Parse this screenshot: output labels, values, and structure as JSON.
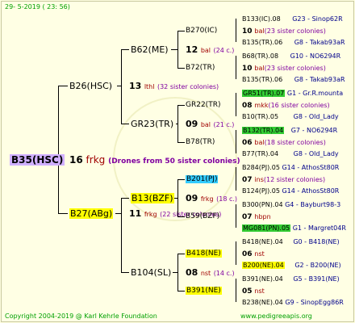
{
  "header": {
    "timestamp": "29-  5-2019 ( 23: 56)"
  },
  "footer": {
    "copyright": "Copyright 2004-2019 @ Karl Kehrle Foundation",
    "site": "www.pedigreeapis.org"
  },
  "root": {
    "label": "B35(HSC)"
  },
  "center": {
    "gen": "16",
    "code": "frkg",
    "note": "(Drones from 50 sister colonies)"
  },
  "p1": {
    "label": "B26(HSC)",
    "gen": "13",
    "code": "lthl",
    "note": "(32 sister colonies)"
  },
  "p2": {
    "label": "B27(ABg)",
    "gen": "11",
    "code": "frkg",
    "note": "(22 sister colonies)"
  },
  "g1": {
    "label": "B62(ME)",
    "gen": "12",
    "code": "bal",
    "note": "(24 c.)"
  },
  "g2": {
    "label": "GR23(TR)",
    "gen": "09",
    "code": "bal",
    "note": "(21 c.)"
  },
  "g3": {
    "label": "B13(BZF)",
    "gen": "09",
    "code": "frkg",
    "note": "(18 c.)"
  },
  "g4": {
    "label": "B104(SL)",
    "gen": "08",
    "code": "nst",
    "note": "(14 c.)"
  },
  "gg": [
    {
      "label": "B270(IC)",
      "gen": "10",
      "code": "bal",
      "note": "(23 sister colonies)"
    },
    {
      "label": "B72(TR)",
      "gen": "10",
      "code": "bal",
      "note": "(23 sister colonies)"
    },
    {
      "label": "GR22(TR)",
      "gen": "08",
      "code": "mkk",
      "note": "(16 sister colonies)"
    },
    {
      "label": "B78(TR)",
      "gen": "06",
      "code": "bal",
      "note": "(18 sister colonies)"
    },
    {
      "label": "B201(PJ)",
      "gen": "07",
      "code": "ins",
      "note": "(12 sister colonies)"
    },
    {
      "label": "B59(BZF)",
      "gen": "07",
      "code": "hbpn",
      "note": ""
    },
    {
      "label": "B418(NE)",
      "gen": "06",
      "code": "nst",
      "note": ""
    },
    {
      "label": "B391(NE)",
      "gen": "05",
      "code": "nst",
      "note": ""
    }
  ],
  "ggg": [
    {
      "id": "B133(IC).08",
      "info": "G23 - Sinop62R"
    },
    {
      "id": "B135(TR).06",
      "info": "G8 - Takab93aR"
    },
    {
      "id": "B68(TR).08",
      "info": "G10 - NO6294R"
    },
    {
      "id": "B135(TR).06",
      "info": "G8 - Takab93aR"
    },
    {
      "id": "GR51(TR).07",
      "info": "G1 - Gr.R.mounta"
    },
    {
      "id": "B10(TR).05",
      "info": "G8 - Old_Lady"
    },
    {
      "id": "B132(TR).04",
      "info": "G7 - NO6294R"
    },
    {
      "id": "B77(TR).04",
      "info": "G8 - Old_Lady"
    },
    {
      "id": "B284(PJ).05",
      "info": "G14 - AthosSt80R"
    },
    {
      "id": "B124(PJ).05",
      "info": "G14 - AthosSt80R"
    },
    {
      "id": "B300(PN).04",
      "info": "G4 - Bayburt98-3"
    },
    {
      "id": "MG081(PN).05",
      "info": "G1 - Margret04R"
    },
    {
      "id": "B418(NE).04",
      "info": "G0 - B418(NE)"
    },
    {
      "id": "B200(NE).04",
      "info": "G2 - B200(NE)"
    },
    {
      "id": "B391(NE).04",
      "info": "G5 - B391(NE)"
    },
    {
      "id": "B238(NE).04",
      "info": "G9 - SinopEgg86R"
    }
  ],
  "colors": {
    "green": "#33cc33",
    "yellow": "#ffff00",
    "cyan": "#33ccff",
    "purple": "#d0b0ff"
  }
}
